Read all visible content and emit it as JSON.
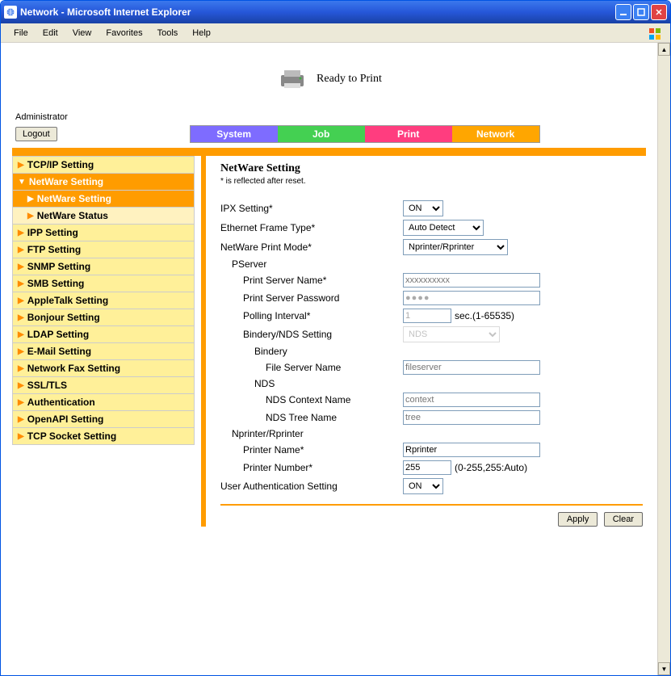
{
  "window": {
    "title": "Network - Microsoft Internet Explorer"
  },
  "menubar": [
    "File",
    "Edit",
    "View",
    "Favorites",
    "Tools",
    "Help"
  ],
  "header": {
    "status_text": "Ready to Print",
    "admin_label": "Administrator",
    "logout_label": "Logout"
  },
  "tabs": {
    "system": "System",
    "job": "Job",
    "print": "Print",
    "network": "Network"
  },
  "sidebar": {
    "items": [
      {
        "label": "TCP/IP Setting",
        "type": "top"
      },
      {
        "label": "NetWare Setting",
        "type": "expanded"
      },
      {
        "label": "NetWare Setting",
        "type": "sub-active"
      },
      {
        "label": "NetWare Status",
        "type": "sub"
      },
      {
        "label": "IPP Setting",
        "type": "top"
      },
      {
        "label": "FTP Setting",
        "type": "top"
      },
      {
        "label": "SNMP Setting",
        "type": "top"
      },
      {
        "label": "SMB Setting",
        "type": "top"
      },
      {
        "label": "AppleTalk Setting",
        "type": "top"
      },
      {
        "label": "Bonjour Setting",
        "type": "top"
      },
      {
        "label": "LDAP Setting",
        "type": "top"
      },
      {
        "label": "E-Mail Setting",
        "type": "top"
      },
      {
        "label": "Network Fax Setting",
        "type": "top"
      },
      {
        "label": "SSL/TLS",
        "type": "top"
      },
      {
        "label": "Authentication",
        "type": "top"
      },
      {
        "label": "OpenAPI Setting",
        "type": "top"
      },
      {
        "label": "TCP Socket Setting",
        "type": "top"
      }
    ]
  },
  "main": {
    "title": "NetWare Setting",
    "note": "* is reflected after reset.",
    "labels": {
      "ipx": "IPX Setting*",
      "frame": "Ethernet Frame Type*",
      "mode": "NetWare Print Mode*",
      "pserver": "PServer",
      "srvname": "Print Server Name*",
      "srvpass": "Print Server Password",
      "poll": "Polling Interval*",
      "poll_hint": "sec.(1-65535)",
      "bnds": "Bindery/NDS Setting",
      "bindery": "Bindery",
      "fileserver": "File Server Name",
      "nds": "NDS",
      "ndsctx": "NDS Context Name",
      "ndstree": "NDS Tree Name",
      "nprp": "Nprinter/Rprinter",
      "pname": "Printer Name*",
      "pnum": "Printer Number*",
      "pnum_hint": "(0-255,255:Auto)",
      "userauth": "User Authentication Setting"
    },
    "values": {
      "ipx": "ON",
      "frame": "Auto Detect",
      "mode": "Nprinter/Rprinter",
      "srvname_ph": "xxxxxxxxxx",
      "srvpass_ph": "●●●●",
      "poll": "1",
      "bnds": "NDS",
      "fileserver_ph": "fileserver",
      "ndsctx_ph": "context",
      "ndstree_ph": "tree",
      "pname": "Rprinter",
      "pnum": "255",
      "userauth": "ON"
    },
    "buttons": {
      "apply": "Apply",
      "clear": "Clear"
    }
  }
}
